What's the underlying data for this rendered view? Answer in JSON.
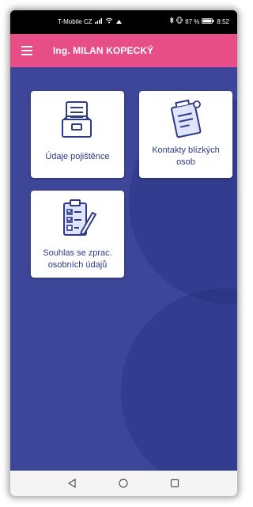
{
  "status_bar": {
    "carrier": "T-Mobile CZ",
    "battery_percent": "87 %",
    "time": "8:52"
  },
  "app_bar": {
    "title": "Ing. MILAN KOPECKÝ",
    "menu_icon": "hamburger-menu-icon",
    "color": "#e64e85"
  },
  "tiles": [
    {
      "label": "Údaje pojištěnce",
      "icon": "archive-box-icon"
    },
    {
      "label": "Kontakty blízkých osob",
      "icon": "document-list-icon"
    },
    {
      "label": "Souhlas se zprac. osobních údajů",
      "icon": "checklist-pen-icon"
    }
  ],
  "nav_bar": {
    "back_icon": "back-triangle-icon",
    "home_icon": "home-circle-icon",
    "recents_icon": "recents-square-icon"
  },
  "colors": {
    "background": "#3d4699",
    "tile_text": "#2f3a86"
  }
}
